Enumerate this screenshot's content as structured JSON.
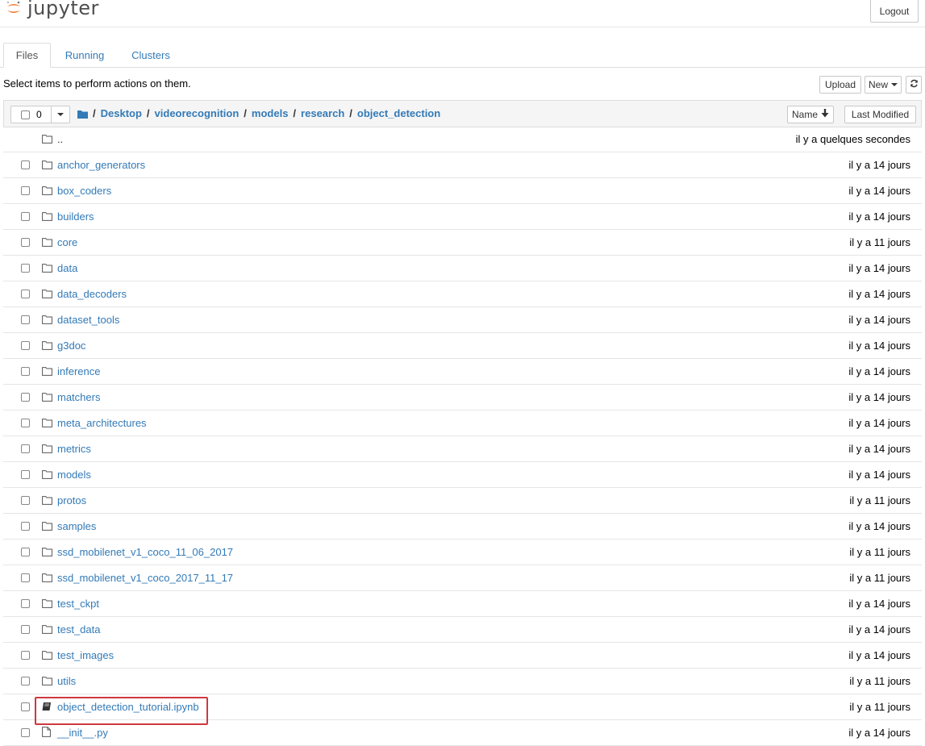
{
  "header": {
    "logo_text": "jupyter",
    "logout_label": "Logout"
  },
  "tabs": [
    {
      "label": "Files",
      "active": true
    },
    {
      "label": "Running",
      "active": false
    },
    {
      "label": "Clusters",
      "active": false
    }
  ],
  "toolbar": {
    "instruction": "Select items to perform actions on them.",
    "upload_label": "Upload",
    "new_label": "New"
  },
  "list_header": {
    "selected_count": "0",
    "breadcrumb": [
      "Desktop",
      "videorecognition",
      "models",
      "research",
      "object_detection"
    ],
    "sort_name_label": "Name",
    "sort_modified_label": "Last Modified"
  },
  "items": [
    {
      "name": "..",
      "type": "parent",
      "modified": "il y a quelques secondes"
    },
    {
      "name": "anchor_generators",
      "type": "folder",
      "modified": "il y a 14 jours"
    },
    {
      "name": "box_coders",
      "type": "folder",
      "modified": "il y a 14 jours"
    },
    {
      "name": "builders",
      "type": "folder",
      "modified": "il y a 14 jours"
    },
    {
      "name": "core",
      "type": "folder",
      "modified": "il y a 11 jours"
    },
    {
      "name": "data",
      "type": "folder",
      "modified": "il y a 14 jours"
    },
    {
      "name": "data_decoders",
      "type": "folder",
      "modified": "il y a 14 jours"
    },
    {
      "name": "dataset_tools",
      "type": "folder",
      "modified": "il y a 14 jours"
    },
    {
      "name": "g3doc",
      "type": "folder",
      "modified": "il y a 14 jours"
    },
    {
      "name": "inference",
      "type": "folder",
      "modified": "il y a 14 jours"
    },
    {
      "name": "matchers",
      "type": "folder",
      "modified": "il y a 14 jours"
    },
    {
      "name": "meta_architectures",
      "type": "folder",
      "modified": "il y a 14 jours"
    },
    {
      "name": "metrics",
      "type": "folder",
      "modified": "il y a 14 jours"
    },
    {
      "name": "models",
      "type": "folder",
      "modified": "il y a 14 jours"
    },
    {
      "name": "protos",
      "type": "folder",
      "modified": "il y a 11 jours"
    },
    {
      "name": "samples",
      "type": "folder",
      "modified": "il y a 14 jours"
    },
    {
      "name": "ssd_mobilenet_v1_coco_11_06_2017",
      "type": "folder",
      "modified": "il y a 11 jours"
    },
    {
      "name": "ssd_mobilenet_v1_coco_2017_11_17",
      "type": "folder",
      "modified": "il y a 11 jours"
    },
    {
      "name": "test_ckpt",
      "type": "folder",
      "modified": "il y a 14 jours"
    },
    {
      "name": "test_data",
      "type": "folder",
      "modified": "il y a 14 jours"
    },
    {
      "name": "test_images",
      "type": "folder",
      "modified": "il y a 14 jours"
    },
    {
      "name": "utils",
      "type": "folder",
      "modified": "il y a 11 jours"
    },
    {
      "name": "object_detection_tutorial.ipynb",
      "type": "notebook",
      "modified": "il y a 11 jours",
      "highlighted": true
    },
    {
      "name": "__init__.py",
      "type": "file",
      "modified": "il y a 14 jours"
    }
  ],
  "colors": {
    "link": "#337ab7",
    "highlight_border": "#d0383f",
    "jupyter_orange": "#f37726"
  }
}
